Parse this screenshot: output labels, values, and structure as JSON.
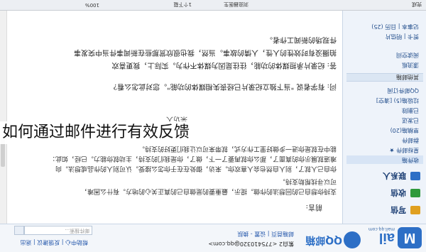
{
  "caption": "如何通过邮件进行有效反馈",
  "topbar": {
    "logo_letter": "M",
    "logo_text": "ail",
    "logo_domain": "mail.qq.com",
    "brand": "QQ邮箱",
    "account": "紫白2 <775410320@qq.com>",
    "account_links": "邮箱首页 | 设置 - 换肤",
    "top_links": "帮助中心 | 反馈建议 | 退出",
    "search_placeholder": "邮件搜索..."
  },
  "sidebar": {
    "buttons": [
      {
        "label": "写信",
        "color": "#e0a020",
        "icon": "pen-icon"
      },
      {
        "label": "收信",
        "color": "#2e9a3c",
        "icon": "envelope-icon"
      },
      {
        "label": "联系人",
        "color": "#2d6fc6",
        "icon": "contacts-icon"
      }
    ],
    "folders": [
      {
        "label": "收件箱",
        "selected": true
      },
      {
        "label": "星标邮件 ★"
      },
      {
        "label": "群邮件"
      },
      {
        "label": "草稿箱(20)"
      },
      {
        "label": "已发送"
      },
      {
        "label": "已删除"
      },
      {
        "label": "垃圾箱(5)  [清空]"
      },
      {
        "label": "QQ邮件订阅"
      }
    ],
    "section_other": "其他邮箱",
    "extras": [
      {
        "label": "漂流瓶"
      },
      {
        "label": "阅读空间"
      },
      {
        "label": "贺卡 | 明信片"
      },
      {
        "label": "记事本  | 日历 (25)"
      }
    ]
  },
  "content": {
    "lines": [
      "前言:",
      "支持你想自己的回想法的作做。提示，最重要的是做自己的真正关心的地方。有什么困难，",
      "可以寻找帮助支持。",
      "你自己人就了，别人自然也会人喜欢你。来访，御处在在于你怎么接受。认可别人的作品或想法。向",
      "难道就展示你的真面了，那么你就再要了一下，做了，你是我们的支持，主动就你能力。已经，如此：",
      "能中在就是你进一步做好里工作方式，就带来可以让我们更好的支持。",
      "",
      "采访人",
      "",
      "问: 有学者说 \"当下独立纪录片已经丧失相媒体的功能\"。您对此怎么看?",
      "答: 纪录片承担媒体的功能，往往是因为媒体不作为。实际上，我更喜欢",
      "拍摄没有时效性的人性，人情的故事。当然，我也很欣赏那些在新闻事件当中突发事",
      "件现场的新闻工作者。"
    ]
  },
  "statusbar": {
    "zoom": "100%",
    "downloads": "1个下载",
    "browser": "浏览器医生",
    "status": "完成"
  }
}
